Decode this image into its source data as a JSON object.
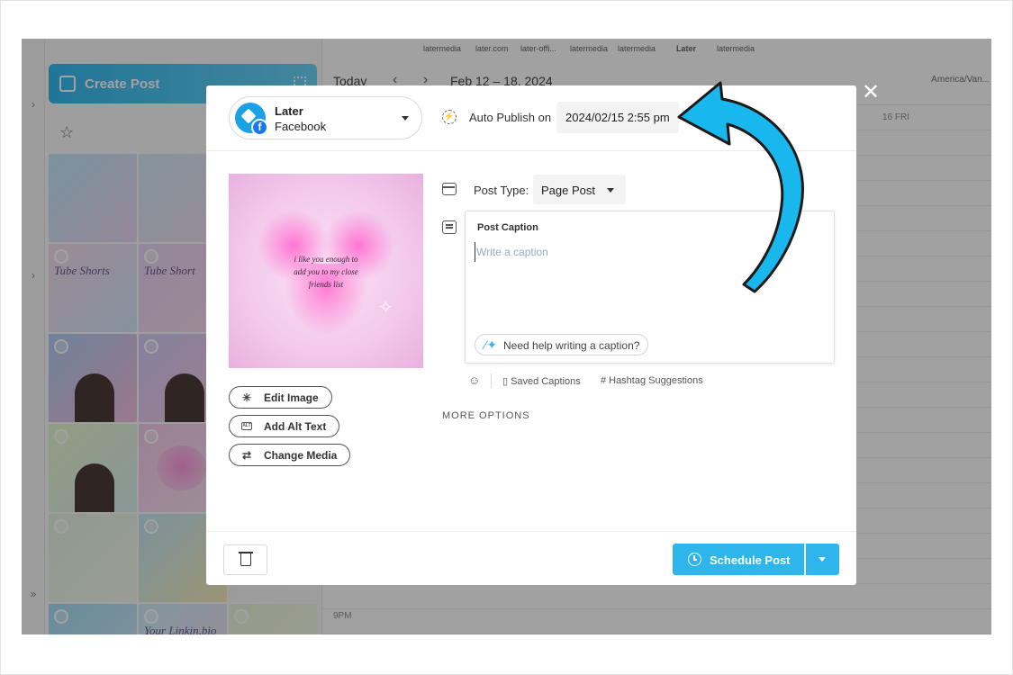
{
  "background": {
    "sidebar": {
      "create_post_label": "Create Post"
    },
    "profile_tabs": [
      "latermedia",
      "later.com",
      "later-offi...",
      "latermedia",
      "latermedia",
      "Later",
      "latermedia"
    ],
    "thumbs": [
      {
        "title": "",
        "bg": "linear-gradient(135deg,#bde6f7,#e9d3f2)"
      },
      {
        "title": "",
        "bg": "linear-gradient(135deg,#d0e8f6,#f0dced)"
      },
      {
        "title": "",
        "bg": "linear-gradient(135deg,#d6f0ea,#e6d8f5)"
      },
      {
        "title": "Tube Shorts",
        "bg": "linear-gradient(135deg,#f6d9ec,#cfe5fb)"
      },
      {
        "title": "Tube Short",
        "bg": "linear-gradient(135deg,#e7d5f7,#f7d6e9)"
      },
      {
        "title": "",
        "bg": "linear-gradient(135deg,#f7f0d5,#e8f6e4)"
      },
      {
        "title": "",
        "bg": "linear-gradient(135deg,#a9c9f5,#f5b8d9)"
      },
      {
        "title": "",
        "bg": "linear-gradient(135deg,#cfc7f7,#f7c7e2)"
      },
      {
        "title": "",
        "bg": "linear-gradient(135deg,#e0e0e0,#f5f5f5)"
      },
      {
        "title": "",
        "bg": "linear-gradient(135deg,#e6f7c9,#d7eef0)"
      },
      {
        "title": "",
        "bg": "linear-gradient(135deg,#f4c7e8,#f9dff1)"
      },
      {
        "title": "",
        "bg": "linear-gradient(135deg,#ededed,#f8f8f8)"
      },
      {
        "title": "",
        "bg": "linear-gradient(135deg,#e3f2e0,#f0f8ec)"
      },
      {
        "title": "",
        "bg": "linear-gradient(135deg,#bfe6f6,#f5e9b5)"
      },
      {
        "title": "",
        "bg": "linear-gradient(135deg,#f1f1f1,#fafafa)"
      },
      {
        "title": "",
        "bg": "linear-gradient(135deg,#9fd9f7,#cde8f5)"
      },
      {
        "title": "Your Linkin.bio",
        "bg": "linear-gradient(135deg,#c9eefa,#f7d8ea)"
      },
      {
        "title": "",
        "bg": "linear-gradient(135deg,#e9f4d8,#f7f7e9)"
      }
    ],
    "calendar": {
      "today_label": "Today",
      "range_label": "Feb 12 – 18, 2024",
      "timezone": "America/Van...",
      "day_label": "16 FRI",
      "hour_label": "9PM"
    }
  },
  "modal": {
    "account": {
      "name": "Later",
      "network": "Facebook"
    },
    "auto_publish_label": "Auto Publish on",
    "auto_publish_datetime": "2024/02/15 2:55 pm",
    "post_type_label": "Post Type:",
    "post_type_value": "Page Post",
    "caption_title": "Post Caption",
    "caption_placeholder": "Write a caption",
    "caption_help_label": "Need help writing a caption?",
    "saved_captions_label": "Saved Captions",
    "hashtag_suggestions_label": "Hashtag Suggestions",
    "more_options_label": "MORE OPTIONS",
    "media_text": "i like you enough to add you to my close friends list",
    "edit_image_label": "Edit Image",
    "add_alt_text_label": "Add Alt Text",
    "alt_badge": "ALT",
    "change_media_label": "Change Media",
    "schedule_label": "Schedule Post",
    "close_glyph": "✕"
  },
  "colors": {
    "accent": "#2db5ec",
    "annotation_arrow": "#18b8ee",
    "facebook": "#1877f2"
  }
}
